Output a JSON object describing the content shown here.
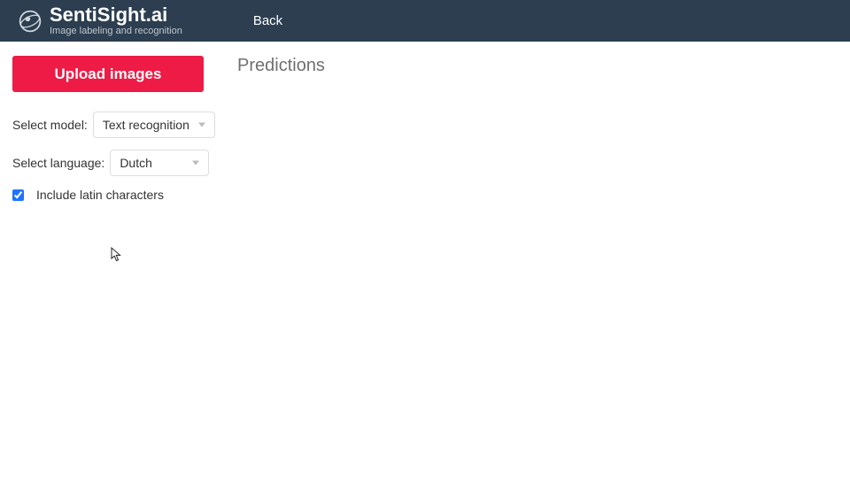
{
  "header": {
    "brand_name": "SentiSight.ai",
    "brand_tag": "Image labeling and recognition",
    "back_label": "Back"
  },
  "sidebar": {
    "upload_label": "Upload images",
    "model_label": "Select model:",
    "model_value": "Text recognition",
    "language_label": "Select language:",
    "language_value": "Dutch",
    "include_latin_label": "Include latin characters",
    "include_latin_checked": true
  },
  "main": {
    "title": "Predictions"
  },
  "colors": {
    "header_bg": "#2c3e50",
    "accent": "#ed1b45",
    "checkbox": "#1e73ff"
  }
}
